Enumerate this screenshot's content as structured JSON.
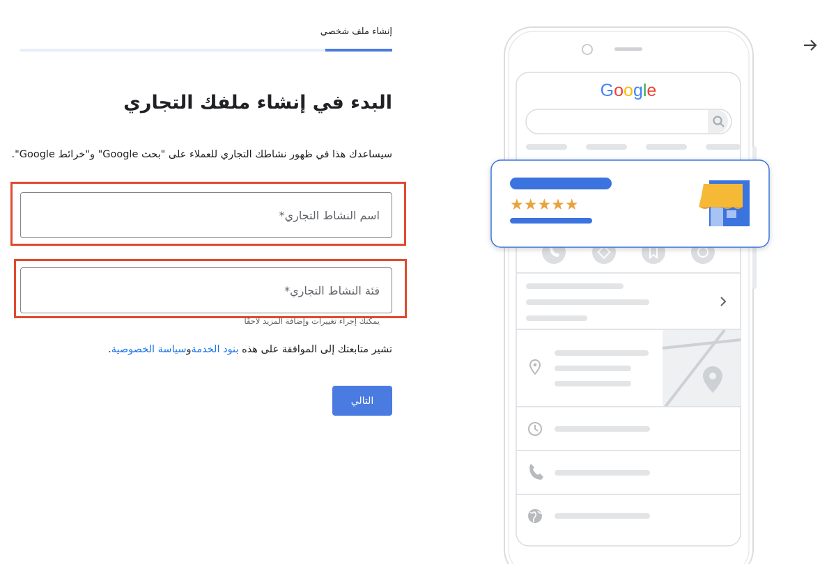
{
  "stepper": {
    "label": "إنشاء ملف شخصي",
    "progress_percent": 18
  },
  "heading": "البدء في إنشاء ملفك التجاري",
  "description": "سيساعدك هذا في ظهور نشاطك التجاري للعملاء على \"بحث Google\" و\"خرائط Google\".",
  "fields": {
    "name_placeholder": "اسم النشاط التجاري*",
    "category_placeholder": "فئة النشاط التجاري*",
    "helper": "يمكنك إجراء تغييرات وإضافة المزيد لاحقًا"
  },
  "consent": {
    "prefix": "تشير متابعتك إلى الموافقة على هذه",
    "terms_link": "بنود الخدمة",
    "joiner": "و",
    "privacy_link": "سياسة الخصوصية",
    "suffix": "."
  },
  "next_button": "التالي",
  "preview": {
    "logo": [
      "G",
      "o",
      "o",
      "g",
      "l",
      "e"
    ],
    "logo_colors": [
      "#4285f4",
      "#ea4335",
      "#fbbc05",
      "#4285f4",
      "#34a853",
      "#ea4335"
    ],
    "stars": "★★★★★",
    "star_rating": 5,
    "colors": {
      "accent": "#3b73df",
      "star": "#e8a33d",
      "awning": "#f5b935",
      "store": "#3b73df",
      "outline": "#dadce0",
      "placeholder_line": "#e3e4e6",
      "icon_gray": "#b8babd"
    },
    "icons": [
      "search-icon",
      "phone-icon",
      "directions-icon",
      "bookmark-icon",
      "website-icon",
      "chevron-right-icon",
      "location-pin-icon",
      "clock-icon",
      "globe-icon",
      "storefront-icon"
    ]
  },
  "nav": {
    "forward_icon": "arrow-right-icon"
  }
}
